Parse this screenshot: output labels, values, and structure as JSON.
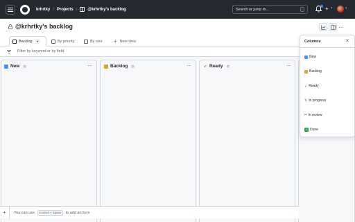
{
  "header": {
    "owner": "krhrtky",
    "separator": "/",
    "projects_label": "Projects",
    "project_name": "@krhrtky's backlog",
    "search_placeholder": "Search or jump to...",
    "search_shortcut": "/"
  },
  "project": {
    "title": "@krhrtky's backlog"
  },
  "tabs": [
    {
      "label": "Backlog",
      "active": true
    },
    {
      "label": "By priority",
      "active": false
    },
    {
      "label": "By size",
      "active": false
    }
  ],
  "new_view_label": "New view",
  "filter_placeholder": "Filter by keyword or by field",
  "columns": [
    {
      "name": "New",
      "count": "0",
      "icon": "new-square-icon",
      "color": "#4493f8"
    },
    {
      "name": "Backlog",
      "count": "0",
      "icon": "notebook-icon",
      "color": "#d4a72c"
    },
    {
      "name": "Ready",
      "count": "0",
      "icon": "rocket-icon",
      "color": "#e05d44"
    }
  ],
  "add_item": {
    "prefix": "You can use",
    "key1": "Control",
    "plus": "+",
    "key2": "Space",
    "suffix": "to add an item"
  },
  "panel": {
    "title": "Columns",
    "items": [
      {
        "label": "New",
        "icon": "new-square-icon",
        "color": "#4493f8"
      },
      {
        "label": "Backlog",
        "icon": "notebook-icon",
        "color": "#d4a72c"
      },
      {
        "label": "Ready",
        "icon": "rocket-icon",
        "color": "#e05d44"
      },
      {
        "label": "In progress",
        "icon": "loop-arrows-icon",
        "color": "#bf8700"
      },
      {
        "label": "In review",
        "icon": "eyes-icon",
        "color": "#57606a"
      },
      {
        "label": "Done",
        "icon": "check-box-icon",
        "color": "#2da44e"
      }
    ]
  }
}
